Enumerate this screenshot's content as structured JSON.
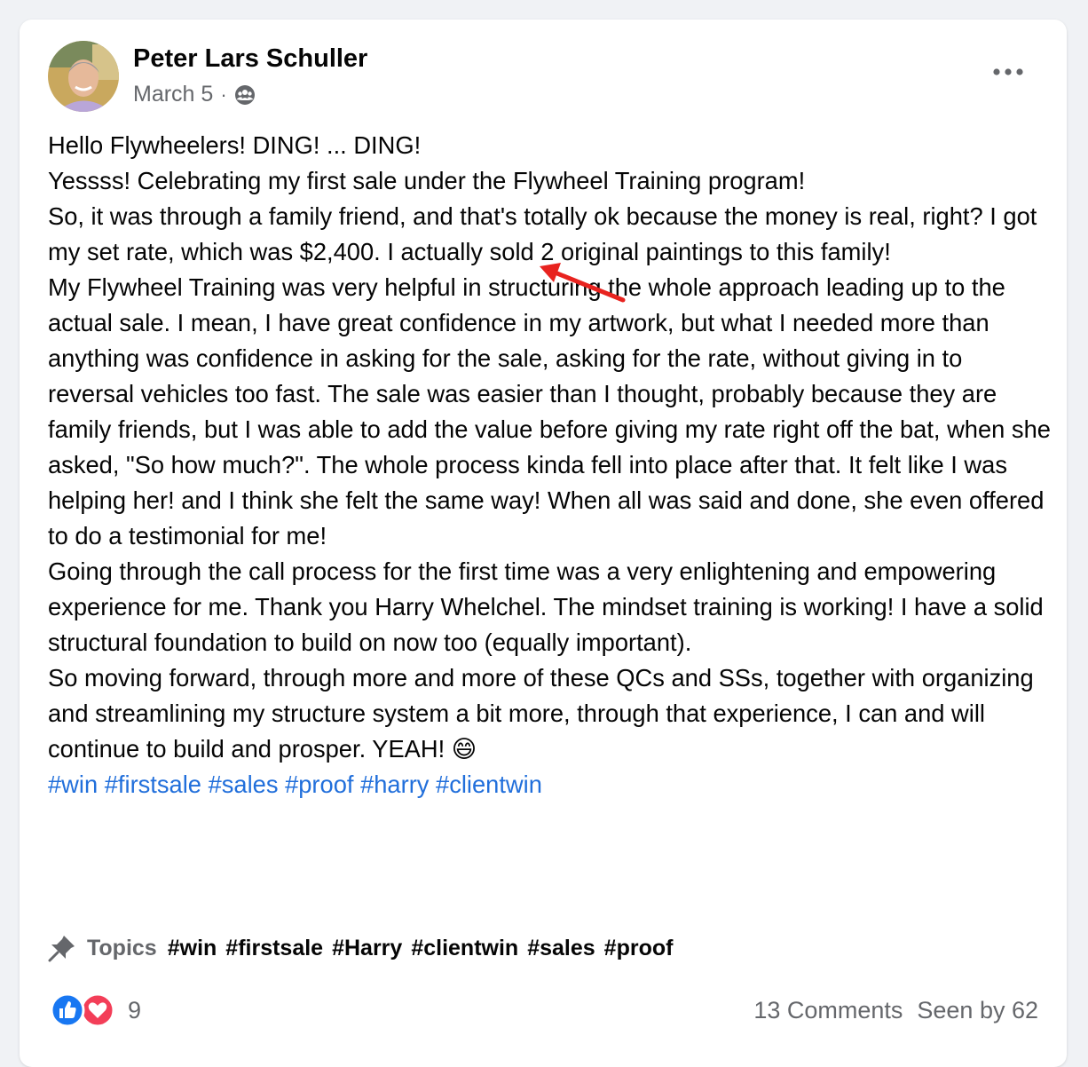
{
  "post": {
    "author": "Peter Lars Schuller",
    "date": "March 5",
    "separator": "·",
    "audience_icon": "group-icon",
    "more_icon": "ellipsis-icon",
    "paragraphs": [
      "Hello Flywheelers!   DING!  ... DING!",
      "Yessss! Celebrating my first sale under the Flywheel Training program!",
      "So, it was through a family friend, and that's totally ok because the money is real, right?  I got my set rate, which was $2,400.  I actually sold 2 original paintings to this family!",
      "My Flywheel Training was very helpful in structuring the whole approach leading up to the actual sale.  I mean, I have great confidence in my artwork, but what I needed more than anything was confidence in asking for the sale, asking for the rate, without giving in to reversal vehicles too fast. The sale was easier than I thought, probably because they are family friends, but I was able to add the value before giving my rate right off the bat, when she asked, \"So how much?\".  The whole process kinda fell into place after that.  It felt like I was helping her! and I think she felt the same way!  When all was said and done, she even offered to do a testimonial for me!",
      "Going through the call process for the first time was a very enlightening and empowering experience for me. Thank you Harry Whelchel. The mindset training is working! I have a solid structural foundation to build on now too (equally important).",
      "So moving forward, through more and more of these QCs and SSs, together with organizing and streamlining my structure system a bit more, through that experience, I can and will continue to build and prosper. YEAH! 😄"
    ],
    "hashtags": [
      "#win",
      "#firstsale",
      "#sales",
      "#proof",
      "#harry",
      "#clientwin"
    ],
    "link_color": "#216fdb",
    "annotation_color": "#e8231f"
  },
  "topics": {
    "icon": "pin-icon",
    "label": "Topics",
    "tags": [
      "#win",
      "#firstsale",
      "#Harry",
      "#clientwin",
      "#sales",
      "#proof"
    ]
  },
  "footer": {
    "reaction_icons": [
      "like-icon",
      "love-icon"
    ],
    "reaction_count": "9",
    "comments": "13 Comments",
    "seen_by": "Seen by 62"
  }
}
